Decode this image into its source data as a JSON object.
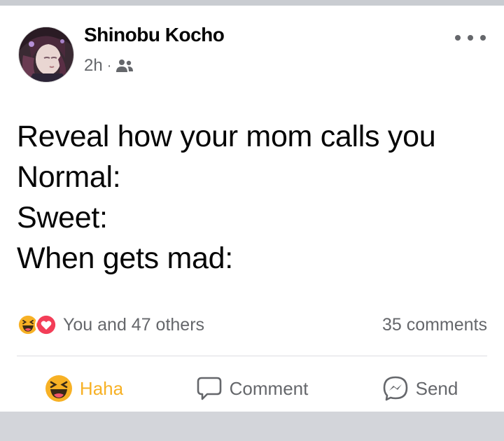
{
  "post": {
    "author": "Shinobu Kocho",
    "time": "2h",
    "separator": "·",
    "audience_icon": "friends-icon",
    "more_icon": "more-options-icon",
    "text_lines": [
      "Reveal how your mom calls you",
      "Normal:",
      "Sweet:",
      "When gets mad:"
    ]
  },
  "reactions": {
    "icons": [
      "haha-icon",
      "love-icon"
    ],
    "summary": "You and 47 others",
    "comments": "35 comments"
  },
  "actions": {
    "haha_label": "Haha",
    "comment_label": "Comment",
    "send_label": "Send"
  },
  "colors": {
    "haha": "#f7b125",
    "love": "#f33e58",
    "secondary_text": "#65676b"
  }
}
